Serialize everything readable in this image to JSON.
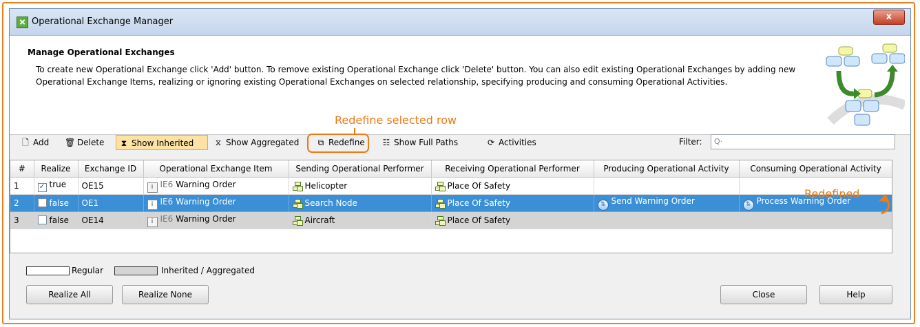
{
  "window": {
    "title": "Operational Exchange Manager",
    "close_label": "x"
  },
  "header": {
    "title": "Manage Operational Exchanges",
    "description": "To create new Operational Exchange click 'Add' button. To remove existing Operational Exchange click 'Delete' button. You can also edit existing Operational Exchanges by adding new Operational Exchange Items, realizing or ignoring existing Operational Exchanges on selected relationship, specifying producing and consuming Operational Activities."
  },
  "annotations": {
    "redefine_row": "Redefine selected row",
    "redefined": "Redefined"
  },
  "toolbar": {
    "add": "Add",
    "delete": "Delete",
    "show_inherited": "Show Inherited",
    "show_aggregated": "Show Aggregated",
    "redefine": "Redefine",
    "show_full_paths": "Show Full Paths",
    "activities": "Activities",
    "filter_label": "Filter:",
    "filter_placeholder": "Q·"
  },
  "table": {
    "columns": [
      "#",
      "Realize",
      "Exchange ID",
      "Operational Exchange Item",
      "Sending Operational Performer",
      "Receiving Operational Performer",
      "Producing Operational Activity",
      "Consuming Operational Activity"
    ],
    "rows": [
      {
        "num": "1",
        "checked": "✓",
        "realize": "true",
        "exchange_id": "OE15",
        "item_prefix": "IE6",
        "item_name": "Warning Order",
        "sending": "Helicopter",
        "receiving": "Place Of Safety",
        "producing": "",
        "consuming": ""
      },
      {
        "num": "2",
        "checked": "",
        "realize": "false",
        "exchange_id": "OE1",
        "item_prefix": "IE6",
        "item_name": "Warning Order",
        "sending": "Search Node",
        "receiving": "Place Of Safety",
        "producing": "Send Warning Order",
        "consuming": "Process Warning Order"
      },
      {
        "num": "3",
        "checked": "",
        "realize": "false",
        "exchange_id": "OE14",
        "item_prefix": "IE6",
        "item_name": "Warning Order",
        "sending": "Aircraft",
        "receiving": "Place Of Safety",
        "producing": "",
        "consuming": ""
      }
    ]
  },
  "legend": {
    "regular": "Regular",
    "inherited": "Inherited / Aggregated"
  },
  "buttons": {
    "realize_all": "Realize All",
    "realize_none": "Realize None",
    "close": "Close",
    "help": "Help"
  },
  "colors": {
    "annotation": "#ee7a12",
    "selection": "#3b8fd6",
    "inherited_row": "#d4d4d4",
    "active_toggle": "#fce3a3"
  }
}
